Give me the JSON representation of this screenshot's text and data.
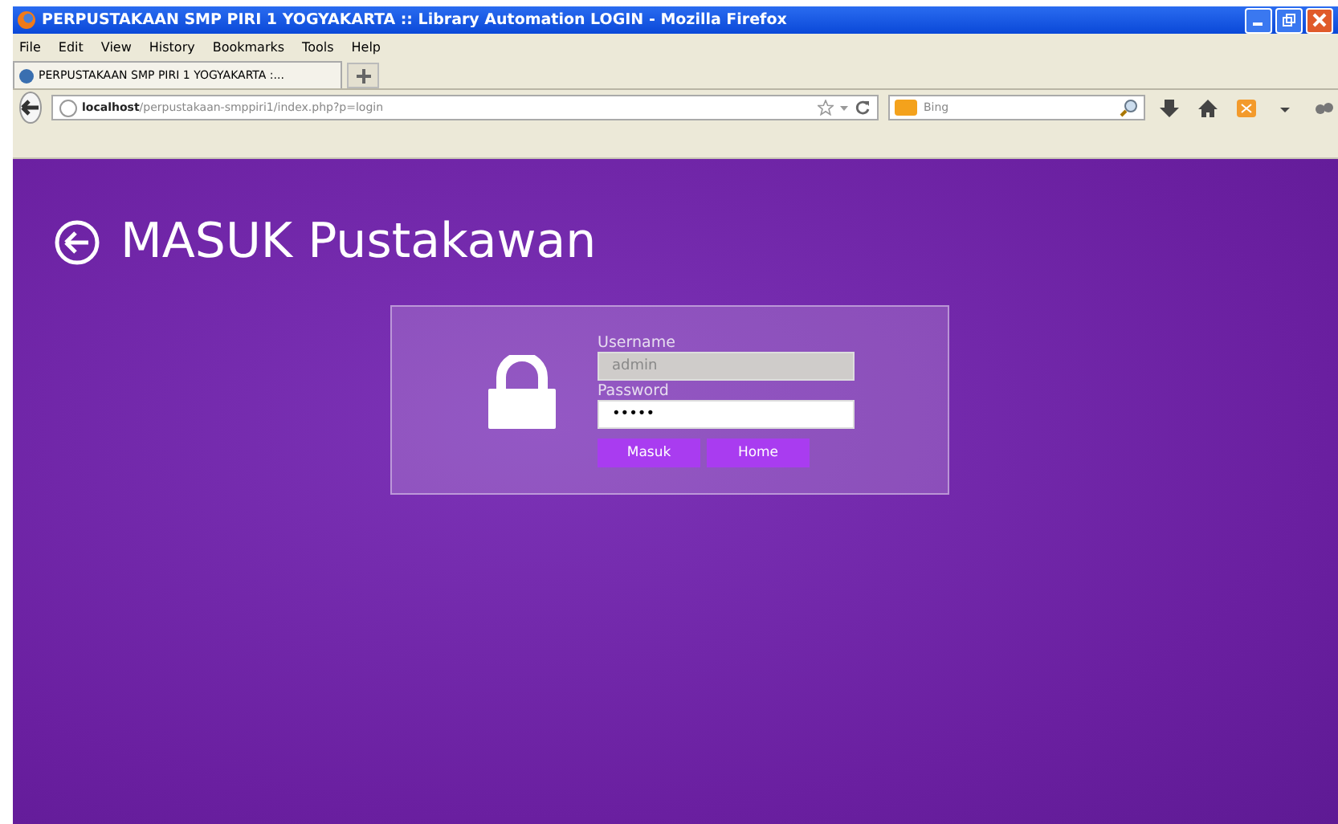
{
  "window": {
    "title": "PERPUSTAKAAN SMP PIRI 1 YOGYAKARTA :: Library Automation LOGIN - Mozilla Firefox"
  },
  "menu": [
    "File",
    "Edit",
    "View",
    "History",
    "Bookmarks",
    "Tools",
    "Help"
  ],
  "tabs": [
    {
      "label": "PERPUSTAKAAN SMP PIRI 1 YOGYAKARTA :...",
      "selected": true
    }
  ],
  "address": {
    "host": "localhost",
    "path": "/perpustakaan-smppiri1/index.php?p=login"
  },
  "search": {
    "placeholder": "Bing"
  },
  "page": {
    "heading": "MASUK Pustakawan",
    "fields": [
      {
        "label": "Username",
        "value": "admin",
        "disabled": true
      },
      {
        "label": "Password",
        "value": "•••••",
        "disabled": false
      }
    ],
    "buttons": [
      "Masuk",
      "Home"
    ]
  }
}
